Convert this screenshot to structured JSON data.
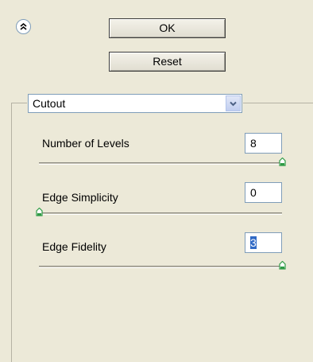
{
  "header": {
    "collapse_icon": "double-chevron-up-icon",
    "ok_label": "OK",
    "reset_label": "Reset"
  },
  "filter": {
    "selected": "Cutout"
  },
  "params": [
    {
      "label": "Number of Levels",
      "value": "8",
      "slider_fraction": 1.0
    },
    {
      "label": "Edge Simplicity",
      "value": "0",
      "slider_fraction": 0.0
    },
    {
      "label": "Edge Fidelity",
      "value": "3",
      "slider_fraction": 1.0
    }
  ],
  "colors": {
    "panel_bg": "#ECE9D8",
    "thumb": "#2E9B45",
    "field_border": "#7F9DB9"
  }
}
